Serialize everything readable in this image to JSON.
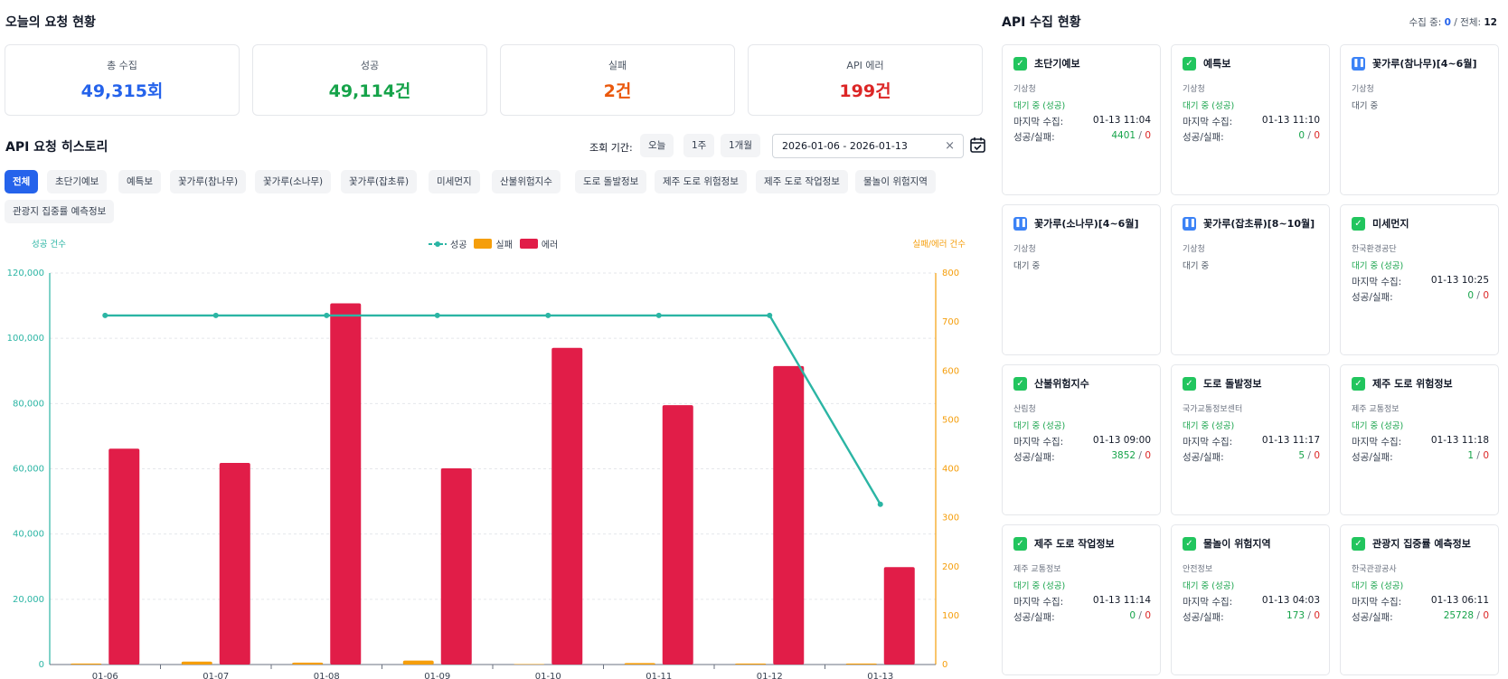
{
  "today": {
    "title": "오늘의 요청 현황",
    "stats": [
      {
        "label": "총 수집",
        "value": "49,315회",
        "color": "#2563eb"
      },
      {
        "label": "성공",
        "value": "49,114건",
        "color": "#16a34a"
      },
      {
        "label": "실패",
        "value": "2건",
        "color": "#ea580c"
      },
      {
        "label": "API 에러",
        "value": "199건",
        "color": "#dc2626"
      }
    ]
  },
  "history": {
    "title": "API 요청 히스토리",
    "period_label": "조회 기간:",
    "period_buttons": [
      "오늘",
      "1주",
      "1개월"
    ],
    "date_range": "2026-01-06 - 2026-01-13",
    "clear_icon": "×",
    "filters": [
      "전체",
      "초단기예보",
      "예특보",
      "꽃가루(참나무)",
      "꽃가루(소나무)",
      "꽃가루(잡초류)",
      "미세먼지",
      "산불위험지수",
      "도로 돌발정보",
      "제주 도로 위험정보",
      "제주 도로 작업정보",
      "물놀이 위험지역",
      "관광지 집중률 예측정보"
    ],
    "active_filter": "전체"
  },
  "chart_data": {
    "type": "bar",
    "categories": [
      "01-06",
      "01-07",
      "01-08",
      "01-09",
      "01-10",
      "01-11",
      "01-12",
      "01-13"
    ],
    "series": [
      {
        "name": "성공",
        "kind": "line",
        "axis": "left",
        "color": "#2bb5a4",
        "values": [
          107000,
          107000,
          107000,
          107000,
          107000,
          107000,
          107000,
          49114
        ]
      },
      {
        "name": "실패",
        "kind": "bar",
        "axis": "right",
        "color": "#f59e0b",
        "values": [
          2,
          6,
          4,
          8,
          1,
          3,
          2,
          2
        ]
      },
      {
        "name": "에러",
        "kind": "bar",
        "axis": "right",
        "color": "#e11d48",
        "values": [
          441,
          412,
          738,
          401,
          647,
          530,
          610,
          199
        ]
      }
    ],
    "ylabel_left": "성공 건수",
    "ylabel_right": "실패/에러 건수",
    "ylim_left": [
      0,
      120000
    ],
    "ylim_right": [
      0,
      800
    ],
    "yticks_left": [
      "0",
      "20,000",
      "40,000",
      "60,000",
      "80,000",
      "100,000",
      "120,000"
    ],
    "yticks_right": [
      "0",
      "100",
      "200",
      "300",
      "400",
      "500",
      "600",
      "700",
      "800"
    ],
    "legend_position": "top-center",
    "grid": true
  },
  "collection": {
    "title": "API 수집 현황",
    "summary_running_label": "수집 중:",
    "summary_running": "0",
    "summary_total_label": "/ 전체:",
    "summary_total": "12",
    "last_label": "마지막 수집:",
    "sf_label": "성공/실패:",
    "cards": [
      {
        "name": "초단기예보",
        "org": "기상청",
        "icon": "check-icon",
        "status": "대기 중 (성공)",
        "last": "01-13 11:04",
        "success": "4401",
        "fail": "0"
      },
      {
        "name": "예특보",
        "org": "기상청",
        "icon": "check-icon",
        "status": "대기 중 (성공)",
        "last": "01-13 11:10",
        "success": "0",
        "fail": "0"
      },
      {
        "name": "꽃가루(참나무)[4~6월]",
        "org": "기상청",
        "icon": "pause-icon",
        "status": "대기 중"
      },
      {
        "name": "꽃가루(소나무)[4~6월]",
        "org": "기상청",
        "icon": "pause-icon",
        "status": "대기 중"
      },
      {
        "name": "꽃가루(잡초류)[8~10월]",
        "org": "기상청",
        "icon": "pause-icon",
        "status": "대기 중"
      },
      {
        "name": "미세먼지",
        "org": "한국환경공단",
        "icon": "check-icon",
        "status": "대기 중 (성공)",
        "last": "01-13 10:25",
        "success": "0",
        "fail": "0"
      },
      {
        "name": "산불위험지수",
        "org": "산림청",
        "icon": "check-icon",
        "status": "대기 중 (성공)",
        "last": "01-13 09:00",
        "success": "3852",
        "fail": "0"
      },
      {
        "name": "도로 돌발정보",
        "org": "국가교통정보센터",
        "icon": "check-icon",
        "status": "대기 중 (성공)",
        "last": "01-13 11:17",
        "success": "5",
        "fail": "0"
      },
      {
        "name": "제주 도로 위험정보",
        "org": "제주 교통정보",
        "icon": "check-icon",
        "status": "대기 중 (성공)",
        "last": "01-13 11:18",
        "success": "1",
        "fail": "0"
      },
      {
        "name": "제주 도로 작업정보",
        "org": "제주 교통정보",
        "icon": "check-icon",
        "status": "대기 중 (성공)",
        "last": "01-13 11:14",
        "success": "0",
        "fail": "0"
      },
      {
        "name": "물놀이 위험지역",
        "org": "안전정보",
        "icon": "check-icon",
        "status": "대기 중 (성공)",
        "last": "01-13 04:03",
        "success": "173",
        "fail": "0"
      },
      {
        "name": "관광지 집중률 예측정보",
        "org": "한국관광공사",
        "icon": "check-icon",
        "status": "대기 중 (성공)",
        "last": "01-13 06:11",
        "success": "25728",
        "fail": "0"
      }
    ]
  }
}
